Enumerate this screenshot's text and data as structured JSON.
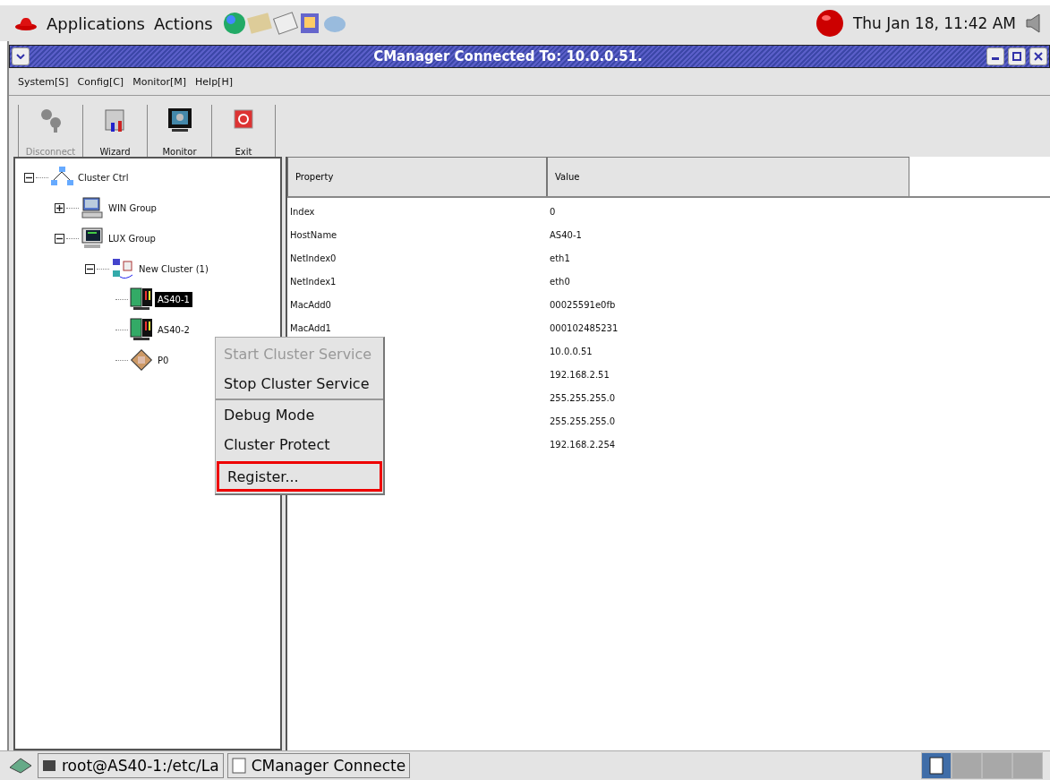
{
  "top_panel": {
    "menus": [
      "Applications",
      "Actions"
    ],
    "clock": "Thu Jan 18, 11:42 AM"
  },
  "window": {
    "title": "CManager Connected To: 10.0.0.51."
  },
  "menu_bar": [
    "System[S]",
    "Config[C]",
    "Monitor[M]",
    "Help[H]"
  ],
  "toolbar": [
    {
      "label": "Disconnect",
      "kind": "disconnect",
      "disabled": true
    },
    {
      "label": "Wizard",
      "kind": "wizard",
      "disabled": false
    },
    {
      "label": "Monitor",
      "kind": "monitor",
      "disabled": false
    },
    {
      "label": "Exit",
      "kind": "exit",
      "disabled": false
    }
  ],
  "tree": [
    {
      "label": "Cluster Ctrl",
      "kind": "network",
      "expanded": true,
      "selected": false,
      "children": [
        {
          "label": "WIN Group",
          "kind": "pc",
          "expanded": false,
          "selected": false
        },
        {
          "label": "LUX Group",
          "kind": "server",
          "expanded": true,
          "selected": false,
          "children": [
            {
              "label": "New Cluster (1)",
              "kind": "cluster",
              "expanded": true,
              "selected": false,
              "children": [
                {
                  "label": "AS40-1",
                  "kind": "node",
                  "selected": true
                },
                {
                  "label": "AS40-2",
                  "kind": "node",
                  "selected": false
                },
                {
                  "label": "P0",
                  "kind": "chip",
                  "selected": false
                }
              ]
            }
          ]
        }
      ]
    }
  ],
  "table": {
    "columns": [
      "Property",
      "Value"
    ],
    "rows": [
      {
        "property": "Index",
        "value": "0"
      },
      {
        "property": "HostName",
        "value": "AS40-1"
      },
      {
        "property": "NetIndex0",
        "value": "eth1"
      },
      {
        "property": "NetIndex1",
        "value": "eth0"
      },
      {
        "property": "MacAdd0",
        "value": "00025591e0fb"
      },
      {
        "property": "MacAdd1",
        "value": "000102485231"
      },
      {
        "value": "10.0.0.51"
      },
      {
        "value": "192.168.2.51"
      },
      {
        "value": "255.255.255.0"
      },
      {
        "value": "255.255.255.0"
      },
      {
        "value": "192.168.2.254"
      }
    ]
  },
  "context_menu": [
    {
      "label": "Start Cluster Service",
      "disabled": true,
      "selected": false
    },
    {
      "label": "Stop Cluster Service",
      "disabled": false,
      "selected": false
    },
    {
      "label": "Debug Mode",
      "disabled": false,
      "selected": false,
      "separator_before": true
    },
    {
      "label": "Cluster Protect",
      "disabled": false,
      "selected": false
    },
    {
      "label": "Register...",
      "disabled": false,
      "selected": true
    }
  ],
  "taskbar": {
    "tasks": [
      "root@AS40-1:/etc/La",
      "CManager Connecte"
    ],
    "workspaces": [
      {
        "selected": true
      },
      {
        "selected": false
      },
      {
        "selected": false
      },
      {
        "selected": false
      }
    ]
  }
}
